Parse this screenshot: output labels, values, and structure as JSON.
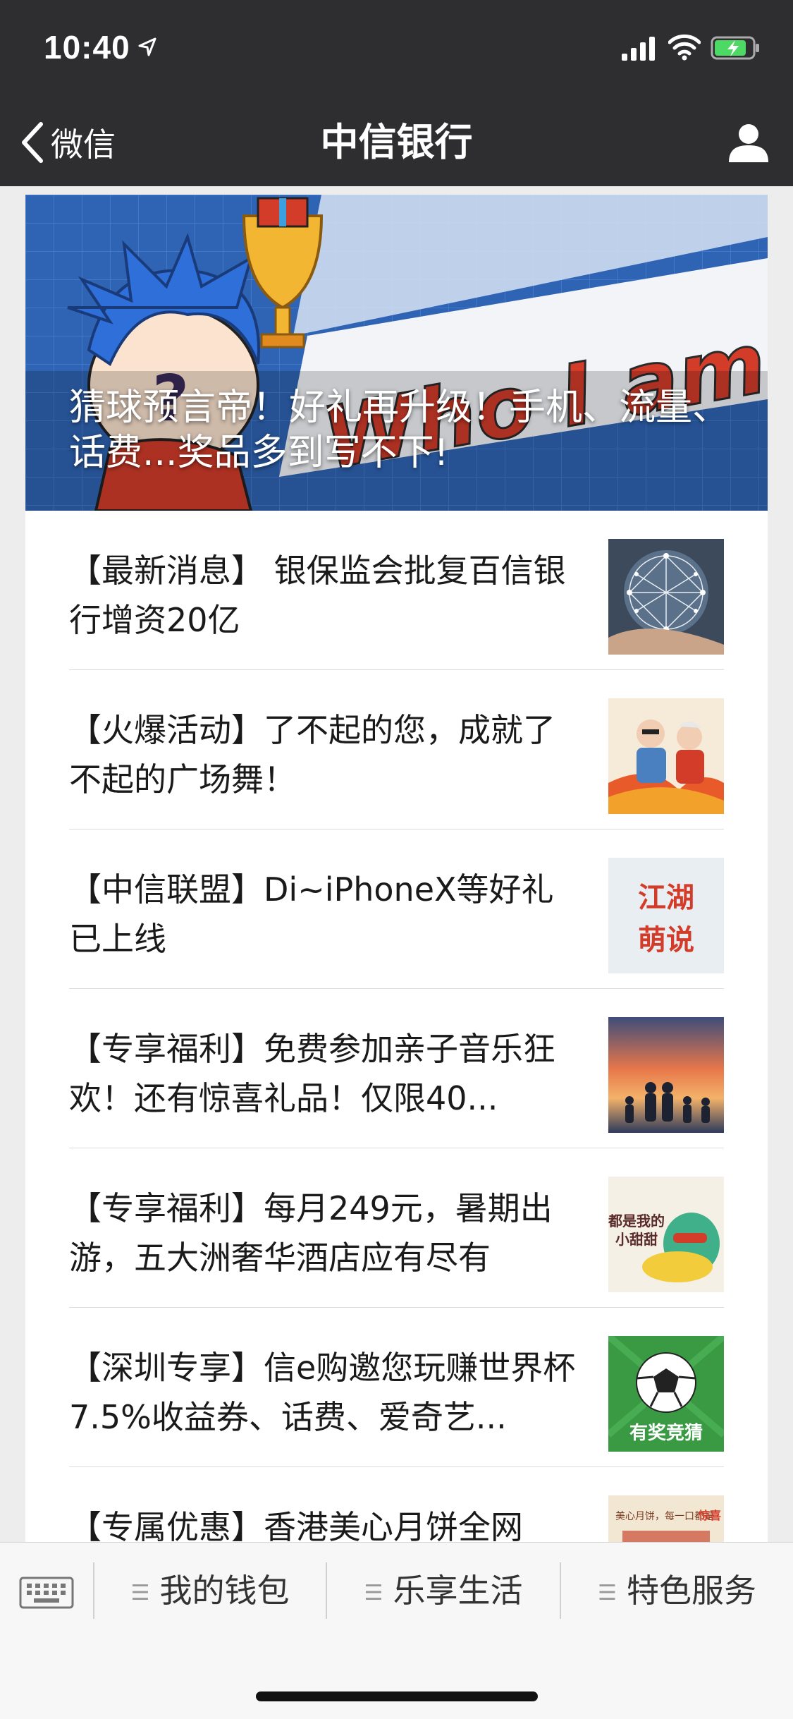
{
  "status": {
    "time": "10:40"
  },
  "nav": {
    "back_label": "微信",
    "title": "中信银行"
  },
  "banner": {
    "title": "猜球预言帝！好礼再升级！手机、流量、话费...奖品多到写不下!",
    "art_text": "Who I am ?"
  },
  "articles": [
    {
      "text": "【最新消息】 银保监会批复百信银行增资20亿",
      "thumb": "network-globe-hand"
    },
    {
      "text": "【火爆活动】了不起的您，成就了不起的广场舞！",
      "thumb": "dancing-seniors"
    },
    {
      "text": "【中信联盟】Di~iPhoneX等好礼已上线",
      "thumb": "jianghu-calligraphy",
      "thumb_text": "江湖 萌说"
    },
    {
      "text": "【专享福利】免费参加亲子音乐狂欢！还有惊喜礼品！仅限40...",
      "thumb": "family-sunset"
    },
    {
      "text": "【专享福利】每月249元，暑期出游，五大洲奢华酒店应有尽有",
      "thumb": "cartoon-sweet",
      "thumb_text": "都是我的小甜甜"
    },
    {
      "text": "【深圳专享】信e购邀您玩赚世界杯 7.5%收益券、话费、爱奇艺...",
      "thumb": "football-quiz",
      "thumb_text": "有奖竞猜"
    },
    {
      "text": "【专属优惠】香港美心月饼全网",
      "thumb": "mooncake-ad",
      "thumb_text": "美心月饼，每一口都是 惊喜"
    }
  ],
  "menu": {
    "items": [
      "我的钱包",
      "乐享生活",
      "特色服务"
    ]
  },
  "colors": {
    "bar": "#2e2e30",
    "banner_blue": "#2f64b5",
    "accent_red": "#d43c2a",
    "green": "#3a9a44"
  }
}
